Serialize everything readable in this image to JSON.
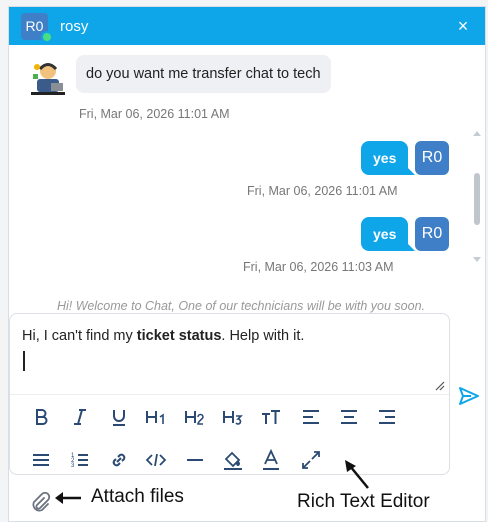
{
  "header": {
    "avatar_initials": "R0",
    "name": "rosy",
    "close_label": "×"
  },
  "messages": [
    {
      "from": "agent",
      "text": "do you want me transfer chat to tech",
      "time": "Fri, Mar 06, 2026 11:01 AM"
    },
    {
      "from": "user",
      "text": "yes",
      "avatar": "R0",
      "time": "Fri, Mar 06, 2026 11:01 AM"
    },
    {
      "from": "user",
      "text": "yes",
      "avatar": "R0",
      "time": "Fri, Mar 06, 2026 11:03 AM"
    }
  ],
  "welcome_text": "Hi! Welcome to Chat, One of our technicians will be with you soon.",
  "composer": {
    "text_before": "Hi, I can't find my ",
    "text_bold": "ticket status",
    "text_after": ". Help with it."
  },
  "toolbar": [
    "bold-icon",
    "italic-icon",
    "underline-icon",
    "heading1-icon",
    "heading2-icon",
    "heading3-icon",
    "font-size-icon",
    "align-left-icon",
    "align-center-icon",
    "align-right-icon",
    "bullet-list-icon",
    "numbered-list-icon",
    "link-icon",
    "code-icon",
    "horizontal-rule-icon",
    "fill-color-icon",
    "text-color-icon",
    "expand-icon"
  ],
  "annotations": {
    "attach": "Attach files",
    "editor": "Rich Text Editor"
  },
  "colors": {
    "accent": "#0ea5e9",
    "avatar": "#3f7fc7",
    "online": "#4ade80"
  }
}
